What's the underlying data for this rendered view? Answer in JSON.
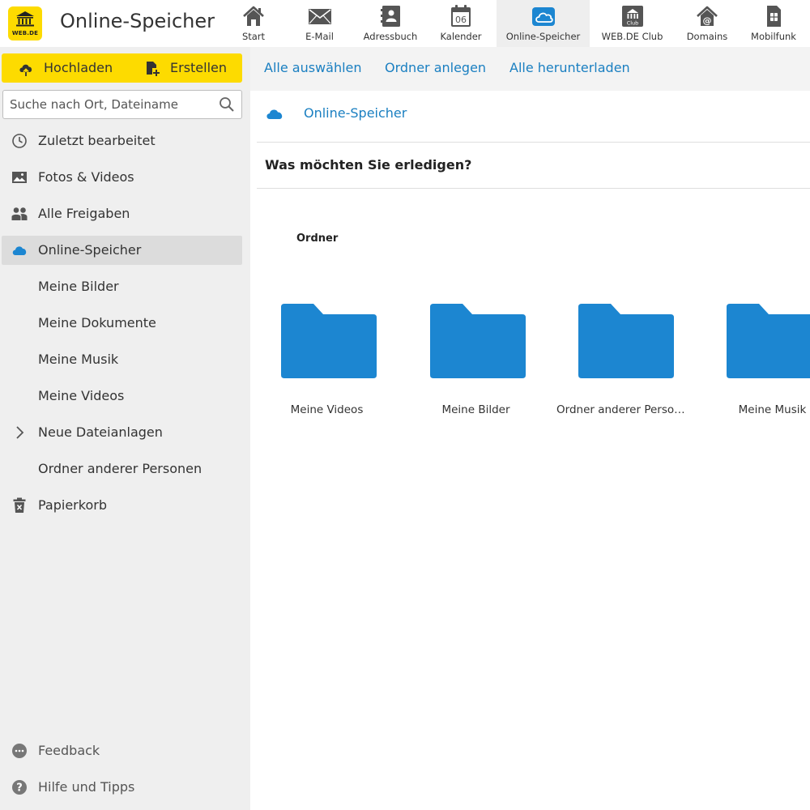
{
  "header": {
    "logo_text": "WEB.DE",
    "title": "Online-Speicher",
    "nav": [
      {
        "label": "Start",
        "icon": "home-icon"
      },
      {
        "label": "E-Mail",
        "icon": "mail-icon"
      },
      {
        "label": "Adressbuch",
        "icon": "address-book-icon"
      },
      {
        "label": "Kalender",
        "icon": "calendar-icon",
        "badge": "06"
      },
      {
        "label": "Online-Speicher",
        "icon": "cloud-icon",
        "active": true
      },
      {
        "label": "WEB.DE Club",
        "icon": "club-icon",
        "badge": "Club"
      },
      {
        "label": "Domains",
        "icon": "domains-icon"
      },
      {
        "label": "Mobilfunk",
        "icon": "sim-card-icon"
      }
    ]
  },
  "toolbar": {
    "upload_label": "Hochladen",
    "create_label": "Erstellen",
    "select_all": "Alle auswählen",
    "new_folder": "Ordner anlegen",
    "download_all": "Alle herunterladen"
  },
  "search": {
    "placeholder": "Suche nach Ort, Dateiname"
  },
  "sidebar": {
    "items": [
      {
        "label": "Zuletzt bearbeitet",
        "icon": "clock-icon"
      },
      {
        "label": "Fotos & Videos",
        "icon": "image-icon"
      },
      {
        "label": "Alle Freigaben",
        "icon": "people-icon"
      },
      {
        "label": "Online-Speicher",
        "icon": "cloud-icon",
        "active": true
      },
      {
        "label": "Meine Bilder"
      },
      {
        "label": "Meine Dokumente"
      },
      {
        "label": "Meine Musik"
      },
      {
        "label": "Meine Videos"
      },
      {
        "label": "Neue Dateianlagen",
        "icon": "chevron-right-icon"
      },
      {
        "label": "Ordner anderer Personen"
      },
      {
        "label": "Papierkorb",
        "icon": "trash-icon"
      }
    ],
    "footer": [
      {
        "label": "Feedback",
        "icon": "feedback-icon"
      },
      {
        "label": "Hilfe und Tipps",
        "icon": "help-icon"
      }
    ]
  },
  "main": {
    "breadcrumb": "Online-Speicher",
    "prompt": "Was möchten Sie erledigen?",
    "section_title": "Ordner",
    "folders": [
      "Meine Videos",
      "Meine Bilder",
      "Ordner anderer Personen",
      "Meine Musik"
    ]
  },
  "colors": {
    "brand_yellow": "#fddb00",
    "link_blue": "#1a7fc1",
    "folder_blue": "#1c86d1",
    "sidebar_bg": "#efefef",
    "active_bg": "#dcdcdc"
  }
}
